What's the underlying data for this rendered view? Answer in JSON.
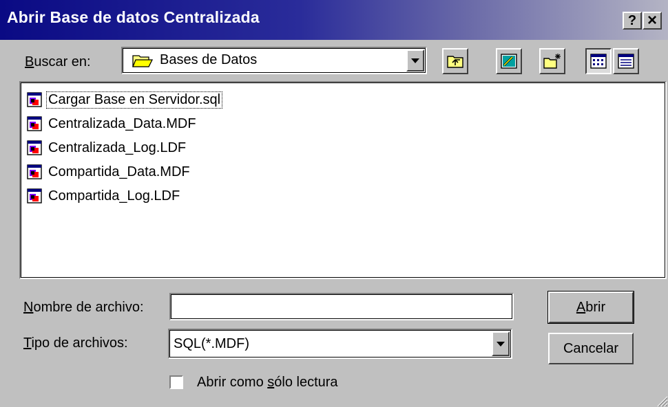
{
  "window": {
    "title": "Abrir Base de datos Centralizada"
  },
  "title_buttons": {
    "help": "?",
    "close": "×"
  },
  "lookin": {
    "label_key": "B",
    "label_rest": "uscar en:",
    "value": "Bases de Datos"
  },
  "toolbar": {
    "buttons": [
      {
        "name": "up-one-level",
        "icon": "folder-up-icon"
      },
      {
        "name": "go-to-desktop",
        "icon": "desktop-icon"
      },
      {
        "name": "create-new-folder",
        "icon": "new-folder-icon"
      },
      {
        "name": "list-view",
        "icon": "list-view-icon",
        "pressed": true
      },
      {
        "name": "details-view",
        "icon": "details-view-icon"
      }
    ]
  },
  "files": [
    {
      "name": "Cargar Base en Servidor.sql",
      "focused": true
    },
    {
      "name": "Centralizada_Data.MDF"
    },
    {
      "name": "Centralizada_Log.LDF"
    },
    {
      "name": "Compartida_Data.MDF"
    },
    {
      "name": "Compartida_Log.LDF"
    }
  ],
  "filename": {
    "label_key": "N",
    "label_rest": "ombre de archivo:",
    "value": ""
  },
  "filetype": {
    "label_key": "T",
    "label_rest": "ipo de archivos:",
    "value": "SQL(*.MDF)"
  },
  "readonly": {
    "label_pre": "Abrir como ",
    "label_key": "s",
    "label_rest": "ólo lectura",
    "checked": false
  },
  "buttons": {
    "open_key": "A",
    "open_rest": "brir",
    "cancel": "Cancelar"
  },
  "colors": {
    "title_start": "#0a0a84",
    "title_end": "#b4b4c4",
    "face": "#c0c0c0"
  }
}
